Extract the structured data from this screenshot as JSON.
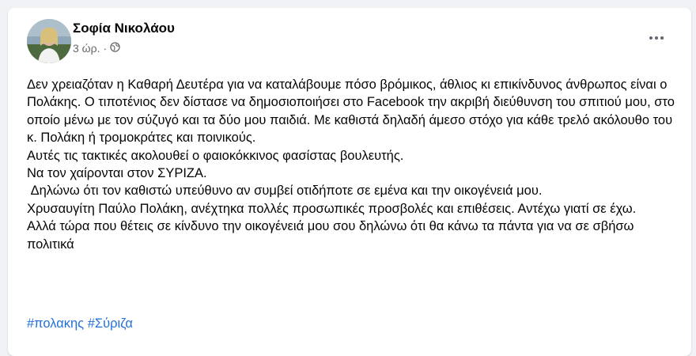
{
  "post": {
    "author": "Σοφία Νικολάου",
    "timestamp": "3 ώρ.",
    "separator": "·",
    "privacy_icon": "globe-icon",
    "menu_icon": "more-options-icon",
    "paragraphs": [
      "Δεν χρειαζόταν η Καθαρή Δευτέρα για να καταλάβουμε πόσο βρόμικος, άθλιος κι επικίνδυνος άνθρωπος είναι ο Πολάκης. Ο τιποτένιος δεν δίστασε να δημοσιοποιήσει στο Facebook την ακριβή διεύθυνση του σπιτιού μου, στο οποίο μένω με τον σύζυγό και τα δύο μου παιδιά. Με καθιστά δηλαδή άμεσο στόχο για κάθε τρελό ακόλουθο του κ. Πολάκη ή τρομοκράτες και ποινικούς.",
      "Αυτές τις τακτικές ακολουθεί ο φαιοκόκκινος φασίστας βουλευτής.",
      "Να τον χαίρονται στον ΣΥΡΙΖΑ.",
      " Δηλώνω ότι τον καθιστώ υπεύθυνο αν συμβεί οτιδήποτε σε εμένα και την οικογένειά μου.",
      "Χρυσαυγίτη Παύλο Πολάκη, ανέχτηκα πολλές προσωπικές προσβολές και επιθέσεις. Αντέχω γιατί σε έχω.",
      "Αλλά τώρα που θέτεις σε κίνδυνο την οικογένειά μου σου δηλώνω ότι θα κάνω τα πάντα για να σε σβήσω πολιτικά"
    ],
    "hashtags": [
      "#πολακης",
      "#Σύριζα"
    ]
  },
  "colors": {
    "background": "#f0f2f5",
    "card": "#ffffff",
    "text": "#050505",
    "meta": "#65676b",
    "link": "#216fdb"
  }
}
